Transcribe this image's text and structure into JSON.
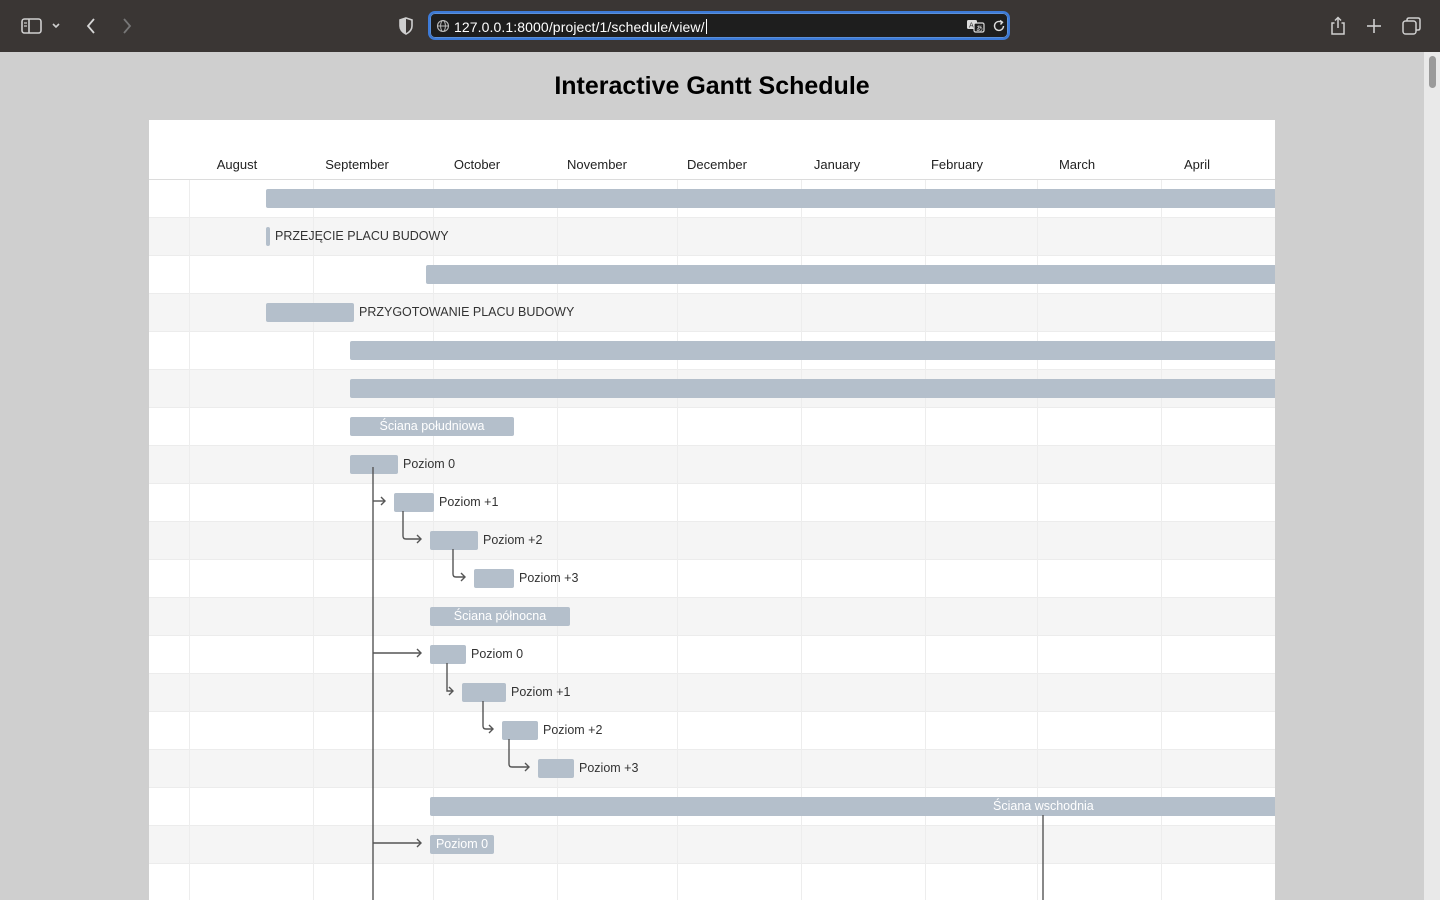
{
  "browser": {
    "url": "127.0.0.1:8000/project/1/schedule/view/"
  },
  "page": {
    "title": "Interactive Gantt Schedule"
  },
  "gantt": {
    "months": [
      "August",
      "September",
      "October",
      "November",
      "December",
      "January",
      "February",
      "March",
      "April"
    ],
    "tasks": [
      {
        "label": ""
      },
      {
        "label": "PRZEJĘCIE PLACU BUDOWY"
      },
      {
        "label": ""
      },
      {
        "label": "PRZYGOTOWANIE PLACU BUDOWY"
      },
      {
        "label": ""
      },
      {
        "label": ""
      },
      {
        "label": "Ściana południowa"
      },
      {
        "label": "Poziom 0"
      },
      {
        "label": "Poziom +1"
      },
      {
        "label": "Poziom +2"
      },
      {
        "label": "Poziom +3"
      },
      {
        "label": "Ściana północna"
      },
      {
        "label": "Poziom 0"
      },
      {
        "label": "Poziom +1"
      },
      {
        "label": "Poziom +2"
      },
      {
        "label": "Poziom +3"
      },
      {
        "label": "Ściana wschodnia"
      },
      {
        "label": "Poziom 0"
      }
    ]
  },
  "colors": {
    "bar": "#b4bfcb",
    "toolbar": "#3a3634",
    "url_focus": "#3d7bd8"
  }
}
